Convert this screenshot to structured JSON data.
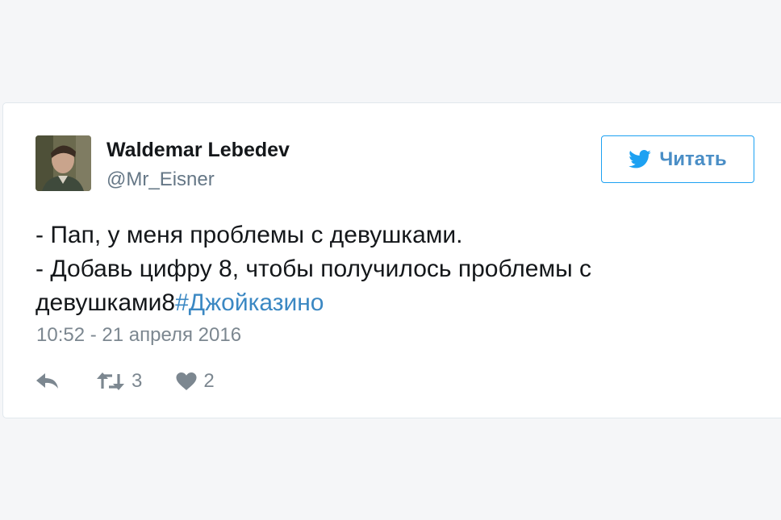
{
  "tweet": {
    "author_name": "Waldemar Lebedev",
    "author_handle": "@Mr_Eisner",
    "follow_label": "Читать",
    "text_line1": "- Пап, у меня проблемы с девушками.",
    "text_line2": "- Добавь цифру 8, чтобы получилось проблемы с",
    "text_line3": "девушками8",
    "hashtag": "#Джойказино",
    "timestamp": "10:52 - 21 апреля 2016",
    "retweet_count": "3",
    "like_count": "2"
  },
  "colors": {
    "accent": "#1da1f2",
    "link": "#3b88c3",
    "muted": "#7c8790"
  },
  "icons": {
    "follow": "twitter-bird-icon",
    "reply": "reply-icon",
    "retweet": "retweet-icon",
    "like": "heart-icon"
  }
}
